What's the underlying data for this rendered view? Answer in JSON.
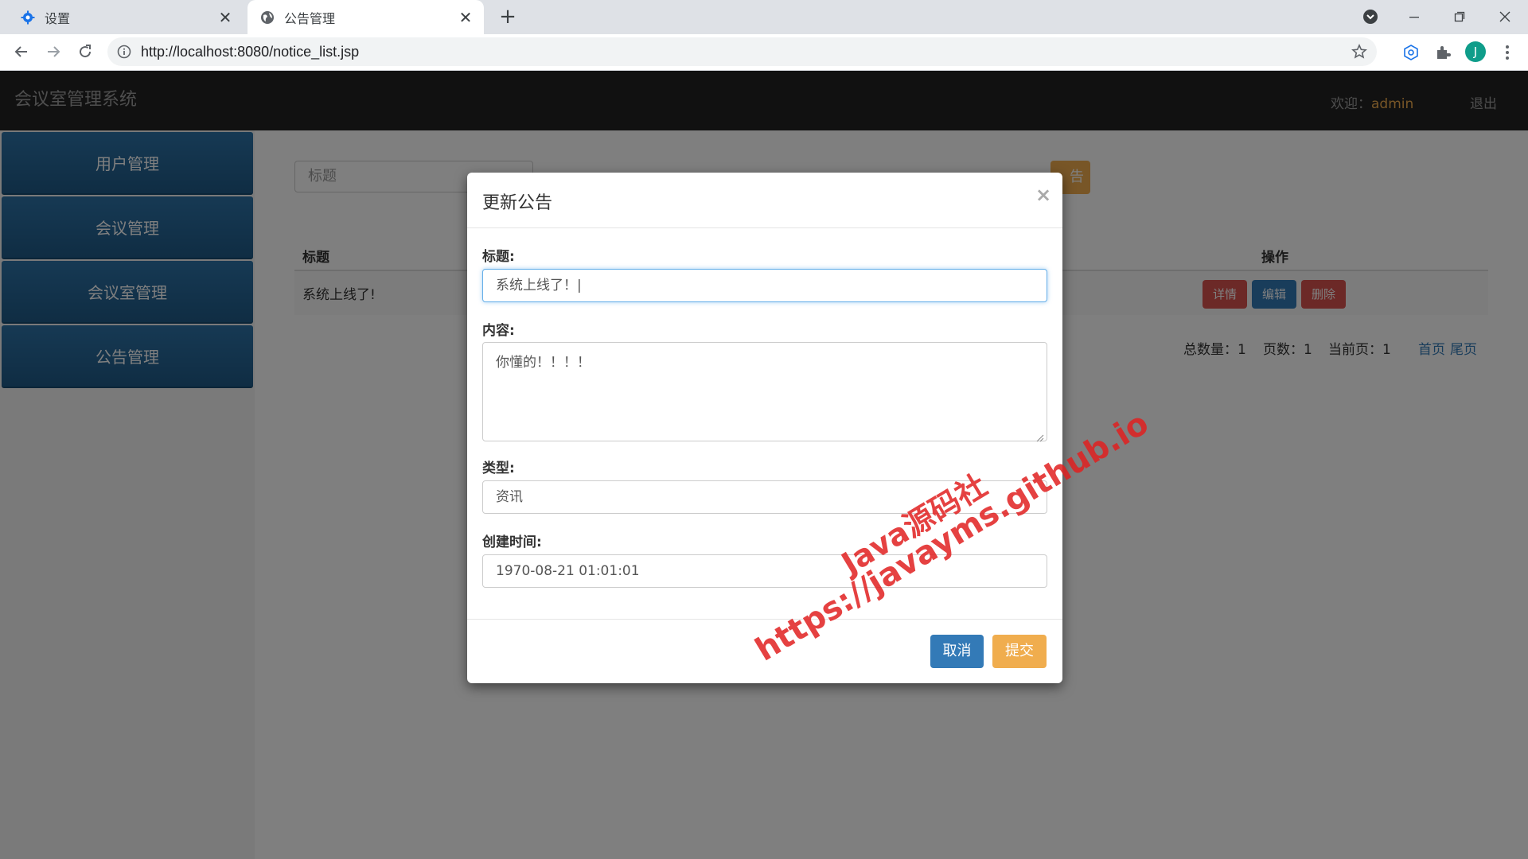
{
  "browser": {
    "tabs": [
      {
        "label": "设置",
        "icon": "gear-icon",
        "active": false
      },
      {
        "label": "公告管理",
        "icon": "globe-icon",
        "active": true
      }
    ],
    "url": "http://localhost:8080/notice_list.jsp",
    "avatar_letter": "J"
  },
  "app": {
    "brand": "会议室管理系统",
    "welcome_label": "欢迎：",
    "username": "admin",
    "logout": "退出",
    "sidebar": [
      {
        "label": "用户管理"
      },
      {
        "label": "会议管理"
      },
      {
        "label": "会议室管理"
      },
      {
        "label": "公告管理"
      }
    ],
    "search_placeholder": "标题",
    "add_button": "告",
    "table": {
      "headers": {
        "title": "标题",
        "ops": "操作"
      },
      "rows": [
        {
          "title": "系统上线了!",
          "ops": [
            "详情",
            "编辑",
            "删除"
          ]
        }
      ]
    },
    "pager": {
      "total": "总数量：1",
      "pages": "页数：1",
      "current": "当前页：1",
      "first": "首页",
      "last": "尾页"
    }
  },
  "modal": {
    "title": "更新公告",
    "close": "×",
    "fields": {
      "title_label": "标题:",
      "title_value": "系统上线了！|",
      "content_label": "内容:",
      "content_value": "你懂的！！！！",
      "type_label": "类型:",
      "type_value": "资讯",
      "created_label": "创建时间:",
      "created_value": "1970-08-21 01:01:01"
    },
    "cancel": "取消",
    "submit": "提交"
  },
  "watermark": {
    "line1": "Java源码社",
    "line2": "https://javayms.github.io",
    "color": "#e02020"
  },
  "colors": {
    "navbar": "#222222",
    "sidebar_item": "#2a6496",
    "warning": "#f0ad4e",
    "danger": "#d9534f",
    "primary": "#337ab7"
  }
}
